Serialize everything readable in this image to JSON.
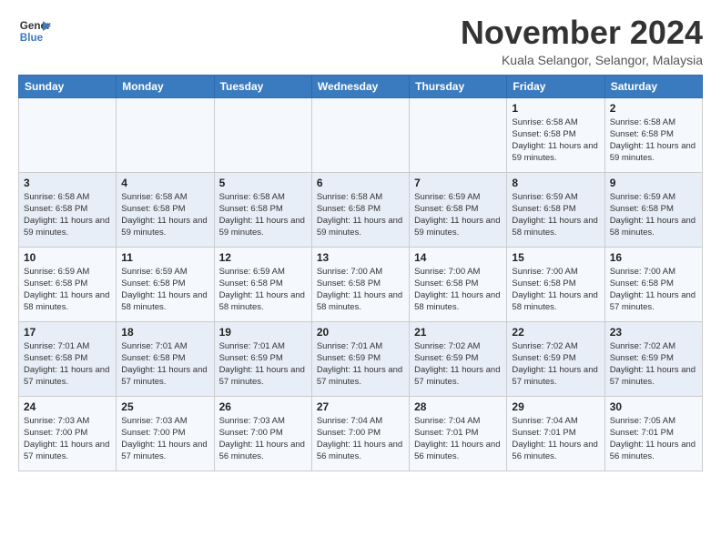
{
  "logo": {
    "text_general": "General",
    "text_blue": "Blue"
  },
  "header": {
    "month_title": "November 2024",
    "subtitle": "Kuala Selangor, Selangor, Malaysia"
  },
  "weekdays": [
    "Sunday",
    "Monday",
    "Tuesday",
    "Wednesday",
    "Thursday",
    "Friday",
    "Saturday"
  ],
  "weeks": [
    [
      {
        "day": "",
        "info": ""
      },
      {
        "day": "",
        "info": ""
      },
      {
        "day": "",
        "info": ""
      },
      {
        "day": "",
        "info": ""
      },
      {
        "day": "",
        "info": ""
      },
      {
        "day": "1",
        "info": "Sunrise: 6:58 AM\nSunset: 6:58 PM\nDaylight: 11 hours and 59 minutes."
      },
      {
        "day": "2",
        "info": "Sunrise: 6:58 AM\nSunset: 6:58 PM\nDaylight: 11 hours and 59 minutes."
      }
    ],
    [
      {
        "day": "3",
        "info": "Sunrise: 6:58 AM\nSunset: 6:58 PM\nDaylight: 11 hours and 59 minutes."
      },
      {
        "day": "4",
        "info": "Sunrise: 6:58 AM\nSunset: 6:58 PM\nDaylight: 11 hours and 59 minutes."
      },
      {
        "day": "5",
        "info": "Sunrise: 6:58 AM\nSunset: 6:58 PM\nDaylight: 11 hours and 59 minutes."
      },
      {
        "day": "6",
        "info": "Sunrise: 6:58 AM\nSunset: 6:58 PM\nDaylight: 11 hours and 59 minutes."
      },
      {
        "day": "7",
        "info": "Sunrise: 6:59 AM\nSunset: 6:58 PM\nDaylight: 11 hours and 59 minutes."
      },
      {
        "day": "8",
        "info": "Sunrise: 6:59 AM\nSunset: 6:58 PM\nDaylight: 11 hours and 58 minutes."
      },
      {
        "day": "9",
        "info": "Sunrise: 6:59 AM\nSunset: 6:58 PM\nDaylight: 11 hours and 58 minutes."
      }
    ],
    [
      {
        "day": "10",
        "info": "Sunrise: 6:59 AM\nSunset: 6:58 PM\nDaylight: 11 hours and 58 minutes."
      },
      {
        "day": "11",
        "info": "Sunrise: 6:59 AM\nSunset: 6:58 PM\nDaylight: 11 hours and 58 minutes."
      },
      {
        "day": "12",
        "info": "Sunrise: 6:59 AM\nSunset: 6:58 PM\nDaylight: 11 hours and 58 minutes."
      },
      {
        "day": "13",
        "info": "Sunrise: 7:00 AM\nSunset: 6:58 PM\nDaylight: 11 hours and 58 minutes."
      },
      {
        "day": "14",
        "info": "Sunrise: 7:00 AM\nSunset: 6:58 PM\nDaylight: 11 hours and 58 minutes."
      },
      {
        "day": "15",
        "info": "Sunrise: 7:00 AM\nSunset: 6:58 PM\nDaylight: 11 hours and 58 minutes."
      },
      {
        "day": "16",
        "info": "Sunrise: 7:00 AM\nSunset: 6:58 PM\nDaylight: 11 hours and 57 minutes."
      }
    ],
    [
      {
        "day": "17",
        "info": "Sunrise: 7:01 AM\nSunset: 6:58 PM\nDaylight: 11 hours and 57 minutes."
      },
      {
        "day": "18",
        "info": "Sunrise: 7:01 AM\nSunset: 6:58 PM\nDaylight: 11 hours and 57 minutes."
      },
      {
        "day": "19",
        "info": "Sunrise: 7:01 AM\nSunset: 6:59 PM\nDaylight: 11 hours and 57 minutes."
      },
      {
        "day": "20",
        "info": "Sunrise: 7:01 AM\nSunset: 6:59 PM\nDaylight: 11 hours and 57 minutes."
      },
      {
        "day": "21",
        "info": "Sunrise: 7:02 AM\nSunset: 6:59 PM\nDaylight: 11 hours and 57 minutes."
      },
      {
        "day": "22",
        "info": "Sunrise: 7:02 AM\nSunset: 6:59 PM\nDaylight: 11 hours and 57 minutes."
      },
      {
        "day": "23",
        "info": "Sunrise: 7:02 AM\nSunset: 6:59 PM\nDaylight: 11 hours and 57 minutes."
      }
    ],
    [
      {
        "day": "24",
        "info": "Sunrise: 7:03 AM\nSunset: 7:00 PM\nDaylight: 11 hours and 57 minutes."
      },
      {
        "day": "25",
        "info": "Sunrise: 7:03 AM\nSunset: 7:00 PM\nDaylight: 11 hours and 57 minutes."
      },
      {
        "day": "26",
        "info": "Sunrise: 7:03 AM\nSunset: 7:00 PM\nDaylight: 11 hours and 56 minutes."
      },
      {
        "day": "27",
        "info": "Sunrise: 7:04 AM\nSunset: 7:00 PM\nDaylight: 11 hours and 56 minutes."
      },
      {
        "day": "28",
        "info": "Sunrise: 7:04 AM\nSunset: 7:01 PM\nDaylight: 11 hours and 56 minutes."
      },
      {
        "day": "29",
        "info": "Sunrise: 7:04 AM\nSunset: 7:01 PM\nDaylight: 11 hours and 56 minutes."
      },
      {
        "day": "30",
        "info": "Sunrise: 7:05 AM\nSunset: 7:01 PM\nDaylight: 11 hours and 56 minutes."
      }
    ]
  ]
}
